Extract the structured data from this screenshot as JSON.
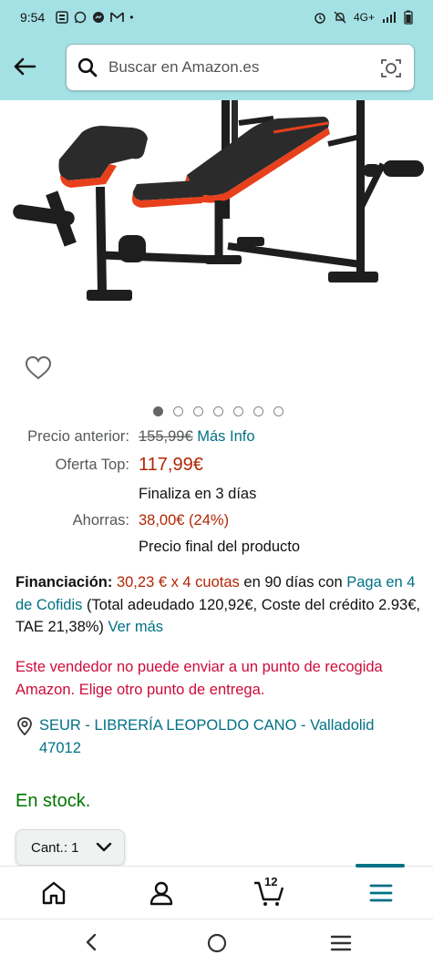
{
  "status_bar": {
    "time": "9:54",
    "network": "4G+"
  },
  "search": {
    "placeholder": "Buscar en Amazon.es"
  },
  "carousel": {
    "total": 7,
    "active": 1
  },
  "pricing": {
    "previous_label": "Precio anterior:",
    "previous_value": "155,99€",
    "more_info": "Más Info",
    "offer_label": "Oferta Top:",
    "offer_value": "117,99€",
    "ends_text": "Finaliza en 3 días",
    "savings_label": "Ahorras:",
    "savings_value": "38,00€ (24%)",
    "final_note": "Precio final del producto"
  },
  "financing": {
    "label": "Financiación:",
    "installments": "30,23 € x 4 cuotas",
    "period": " en 90 días con",
    "provider_link": "Paga en 4 de Cofidis",
    "details": " (Total adeudado 120,92€, Coste del crédito 2.93€, TAE 21,38%) ",
    "more_link": "Ver más"
  },
  "delivery": {
    "warning": "Este vendedor no puede enviar a un punto de recogida Amazon. Elige otro punto de entrega.",
    "pickup_point": "SEUR - LIBRERÍA LEOPOLDO CANO - Valladolid 47012"
  },
  "stock": {
    "status": "En stock."
  },
  "quantity": {
    "label": "Cant.: 1"
  },
  "bottom_nav": {
    "cart_count": "12",
    "active_tab": "menu"
  },
  "colors": {
    "header_bg": "#a4e1e4",
    "link": "#007185",
    "price_red": "#b12704",
    "warning_red": "#cc0c39",
    "stock_green": "#007600"
  }
}
